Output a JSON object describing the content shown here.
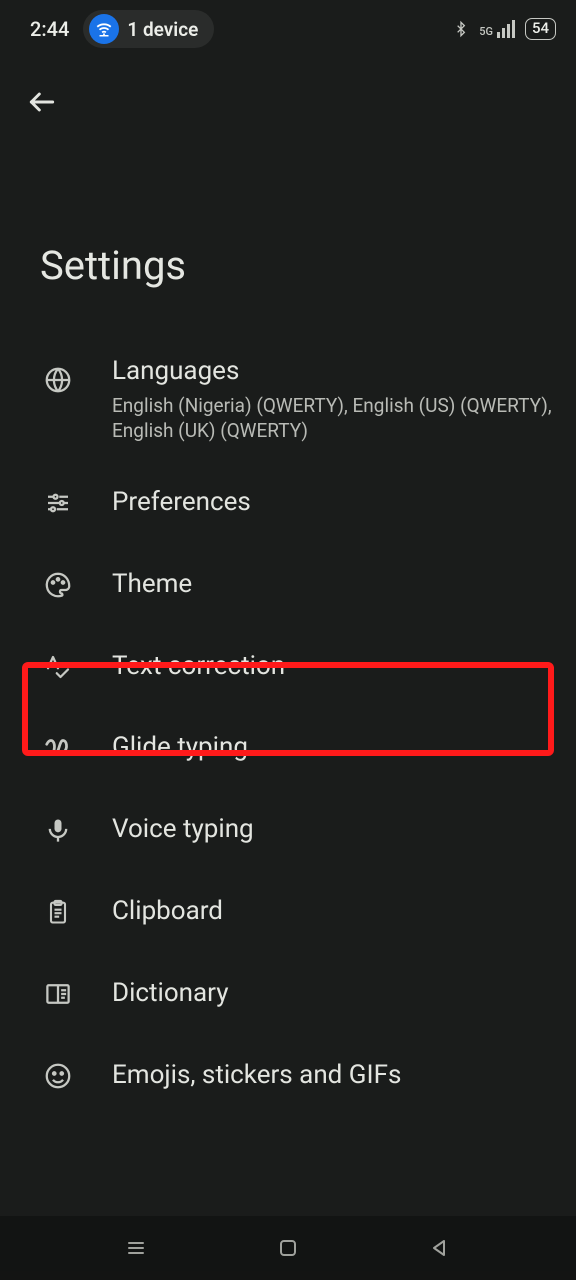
{
  "status": {
    "time": "2:44",
    "device_count": "1 device",
    "network": "5G",
    "battery": "54"
  },
  "page": {
    "title": "Settings"
  },
  "items": [
    {
      "label": "Languages",
      "sub": "English (Nigeria) (QWERTY), English (US) (QWERTY), English (UK) (QWERTY)"
    },
    {
      "label": "Preferences"
    },
    {
      "label": "Theme"
    },
    {
      "label": "Text correction"
    },
    {
      "label": "Glide typing"
    },
    {
      "label": "Voice typing"
    },
    {
      "label": "Clipboard"
    },
    {
      "label": "Dictionary"
    },
    {
      "label": "Emojis, stickers and GIFs"
    }
  ],
  "highlight_index": 3
}
